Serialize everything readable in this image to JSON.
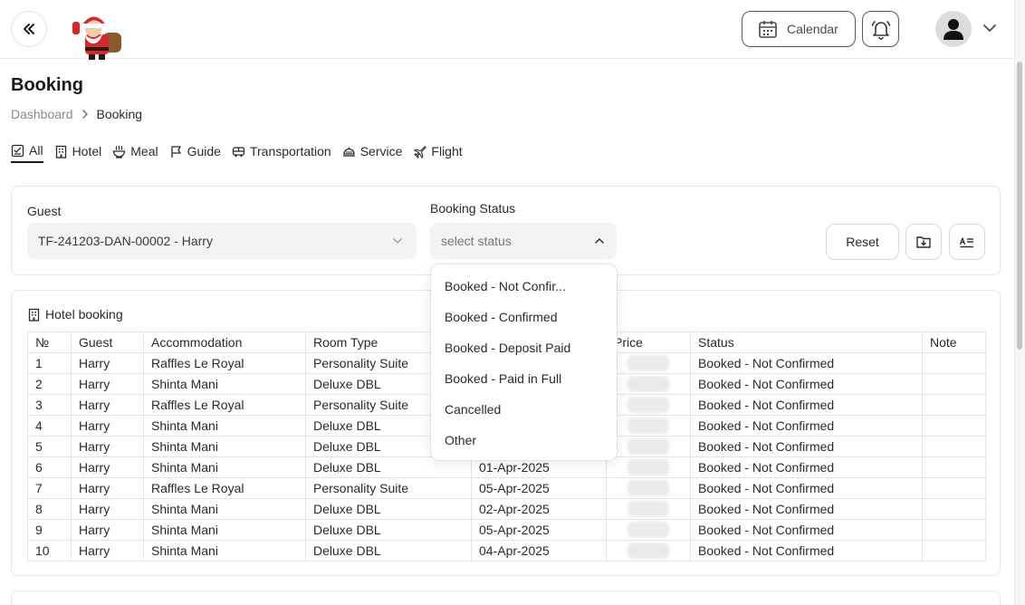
{
  "header": {
    "calendar_label": "Calendar"
  },
  "page": {
    "title": "Booking",
    "breadcrumb": {
      "home": "Dashboard",
      "current": "Booking"
    }
  },
  "tabs": [
    {
      "label": "All",
      "icon": "checklist-icon"
    },
    {
      "label": "Hotel",
      "icon": "building-icon"
    },
    {
      "label": "Meal",
      "icon": "bowl-icon"
    },
    {
      "label": "Guide",
      "icon": "flag-icon"
    },
    {
      "label": "Transportation",
      "icon": "bus-icon"
    },
    {
      "label": "Service",
      "icon": "service-bell-icon"
    },
    {
      "label": "Flight",
      "icon": "plane-icon"
    }
  ],
  "filters": {
    "guest_label": "Guest",
    "guest_value": "TF-241203-DAN-00002 - Harry",
    "status_label": "Booking Status",
    "status_placeholder": "select status",
    "reset_label": "Reset"
  },
  "status_options": [
    "Booked - Not Confir...",
    "Booked - Confirmed",
    "Booked - Deposit Paid",
    "Booked - Paid in Full",
    "Cancelled",
    "Other"
  ],
  "hotel_table": {
    "title": "Hotel booking",
    "columns": [
      "№",
      "Guest",
      "Accommodation",
      "Room Type",
      "",
      "Price",
      "Status",
      "Note"
    ],
    "rows": [
      [
        "1",
        "Harry",
        "Raffles Le Royal",
        "Personality Suite",
        "",
        "",
        "Booked - Not Confirmed",
        ""
      ],
      [
        "2",
        "Harry",
        "Shinta Mani",
        "Deluxe DBL",
        "",
        "",
        "Booked - Not Confirmed",
        ""
      ],
      [
        "3",
        "Harry",
        "Raffles Le Royal",
        "Personality Suite",
        "",
        "",
        "Booked - Not Confirmed",
        ""
      ],
      [
        "4",
        "Harry",
        "Shinta Mani",
        "Deluxe DBL",
        "",
        "",
        "Booked - Not Confirmed",
        ""
      ],
      [
        "5",
        "Harry",
        "Shinta Mani",
        "Deluxe DBL",
        "",
        "",
        "Booked - Not Confirmed",
        ""
      ],
      [
        "6",
        "Harry",
        "Shinta Mani",
        "Deluxe DBL",
        "01-Apr-2025",
        "",
        "Booked - Not Confirmed",
        ""
      ],
      [
        "7",
        "Harry",
        "Raffles Le Royal",
        "Personality Suite",
        "05-Apr-2025",
        "",
        "Booked - Not Confirmed",
        ""
      ],
      [
        "8",
        "Harry",
        "Shinta Mani",
        "Deluxe DBL",
        "02-Apr-2025",
        "",
        "Booked - Not Confirmed",
        ""
      ],
      [
        "9",
        "Harry",
        "Shinta Mani",
        "Deluxe DBL",
        "05-Apr-2025",
        "",
        "Booked - Not Confirmed",
        ""
      ],
      [
        "10",
        "Harry",
        "Shinta Mani",
        "Deluxe DBL",
        "04-Apr-2025",
        "",
        "Booked - Not Confirmed",
        ""
      ]
    ]
  }
}
